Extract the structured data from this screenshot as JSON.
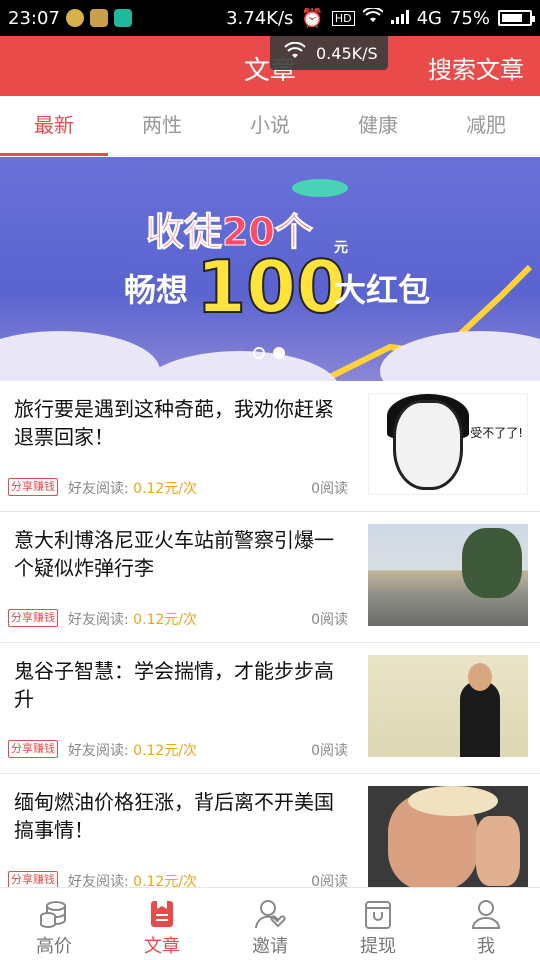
{
  "status_bar": {
    "time": "23:07",
    "net_speed": "3.74K/s",
    "hd": "HD",
    "network": "4G",
    "battery": "75%",
    "battery_level": 0.75
  },
  "speed_toast": "0.45K/S",
  "header": {
    "title": "文章",
    "search_label": "搜索文章",
    "bg_color": "#e94b4b"
  },
  "tabs": [
    {
      "label": "最新",
      "active": true
    },
    {
      "label": "两性",
      "active": false
    },
    {
      "label": "小说",
      "active": false
    },
    {
      "label": "健康",
      "active": false
    },
    {
      "label": "减肥",
      "active": false
    }
  ],
  "banner": {
    "line1": "收徒20个",
    "line2": "畅想",
    "amount": "100",
    "unit": "元",
    "line3": "大红包",
    "page_count": 2,
    "active_page": 2
  },
  "articles": [
    {
      "title": "旅行要是遇到这种奇葩，我劝你赶紧退票回家！",
      "tag": "分享赚钱",
      "friend_label": "好友阅读:",
      "price": "0.12元/次",
      "reads": "0阅读",
      "thumb_text": "受不了了!"
    },
    {
      "title": "意大利博洛尼亚火车站前警察引爆一个疑似炸弹行李",
      "tag": "分享赚钱",
      "friend_label": "好友阅读:",
      "price": "0.12元/次",
      "reads": "0阅读"
    },
    {
      "title": "鬼谷子智慧：学会揣情，才能步步高升",
      "tag": "分享赚钱",
      "friend_label": "好友阅读:",
      "price": "0.12元/次",
      "reads": "0阅读"
    },
    {
      "title": "缅甸燃油价格狂涨，背后离不开美国搞事情！",
      "tag": "分享赚钱",
      "friend_label": "好友阅读:",
      "price": "0.12元/次",
      "reads": "0阅读"
    }
  ],
  "bottom_nav": [
    {
      "label": "高价",
      "icon": "coins-icon",
      "active": false
    },
    {
      "label": "文章",
      "icon": "article-icon",
      "active": true
    },
    {
      "label": "邀请",
      "icon": "invite-icon",
      "active": false
    },
    {
      "label": "提现",
      "icon": "wallet-icon",
      "active": false
    },
    {
      "label": "我",
      "icon": "profile-icon",
      "active": false
    }
  ]
}
